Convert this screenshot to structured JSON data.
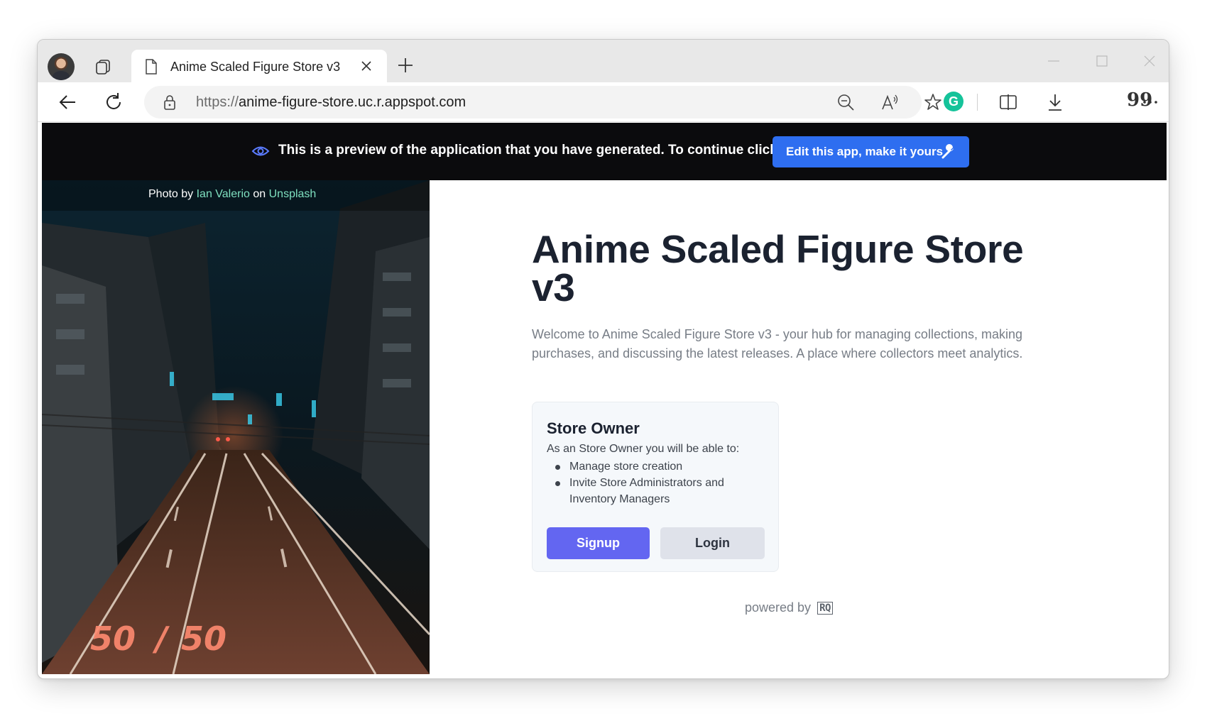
{
  "browser": {
    "tab_title": "Anime Scaled Figure Store v3",
    "url_protocol": "https://",
    "url_host": "anime-figure-store.uc.r.appspot.com",
    "quote_label": "99",
    "grammarly_label": "G"
  },
  "banner": {
    "message": "This is a preview of the application that you have generated. To continue click here:",
    "button_label": "Edit this app, make it yours"
  },
  "photo_credit": {
    "prefix": "Photo by",
    "author": "Ian Valerio",
    "middle": "on",
    "source": "Unsplash"
  },
  "hero": {
    "title": "Anime Scaled Figure Store v3",
    "description": "Welcome to Anime Scaled Figure Store v3 - your hub for managing collections, making purchases, and discussing the latest releases. A place where collectors meet analytics."
  },
  "role_card": {
    "title": "Store Owner",
    "subtitle": "As an Store Owner you will be able to:",
    "items": [
      "Manage store creation",
      "Invite Store Administrators and Inventory Managers"
    ],
    "signup_label": "Signup",
    "login_label": "Login"
  },
  "footer": {
    "powered_by": "powered by",
    "logo_text": "RQ"
  },
  "colors": {
    "banner_bg": "#0b0b0d",
    "edit_button": "#2e6ef0",
    "signup_button": "#6366f1",
    "login_button": "#dfe2ea",
    "link_accent": "#7fe0c0"
  }
}
